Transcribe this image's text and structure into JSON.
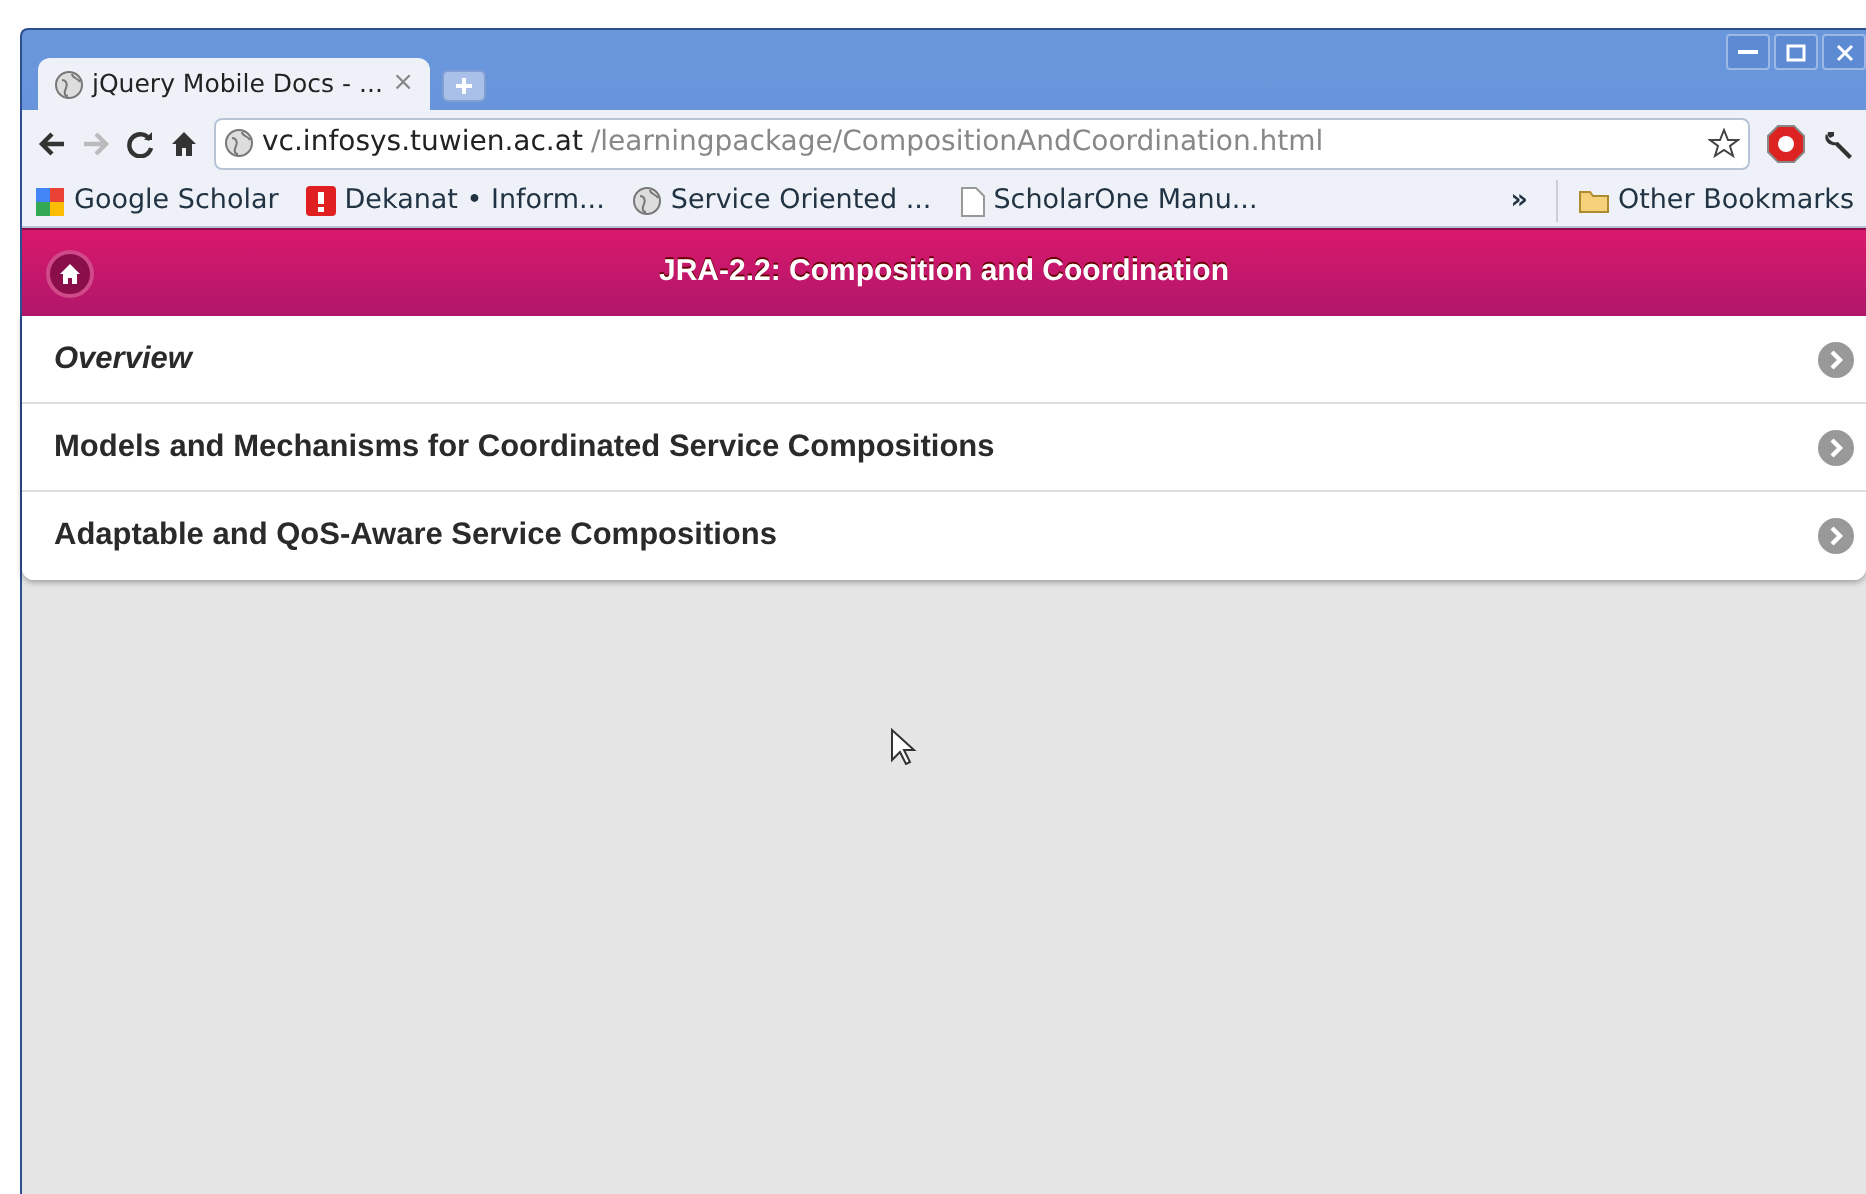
{
  "browser": {
    "tabs": [
      {
        "title": "jQuery Mobile Docs - ...",
        "close": "×",
        "selected": true
      }
    ],
    "url": {
      "host": "vc.infosys.tuwien.ac.at",
      "path": "/learningpackage/CompositionAndCoordination.html"
    },
    "bookmarks": [
      {
        "label": "Google Scholar",
        "kind": "scholar"
      },
      {
        "label": "Dekanat • Inform...",
        "kind": "alert"
      },
      {
        "label": "Service Oriented ...",
        "kind": "globe"
      },
      {
        "label": "ScholarOne Manu...",
        "kind": "page"
      }
    ],
    "overflow": "»",
    "other_bookmarks": "Other Bookmarks"
  },
  "page": {
    "header": {
      "title": "JRA-2.2: Composition and Coordination"
    },
    "items": [
      {
        "label": "Overview",
        "italic": true
      },
      {
        "label": "Models and Mechanisms for Coordinated Service Compositions",
        "italic": false
      },
      {
        "label": "Adaptable and QoS-Aware Service Compositions",
        "italic": false
      }
    ]
  }
}
